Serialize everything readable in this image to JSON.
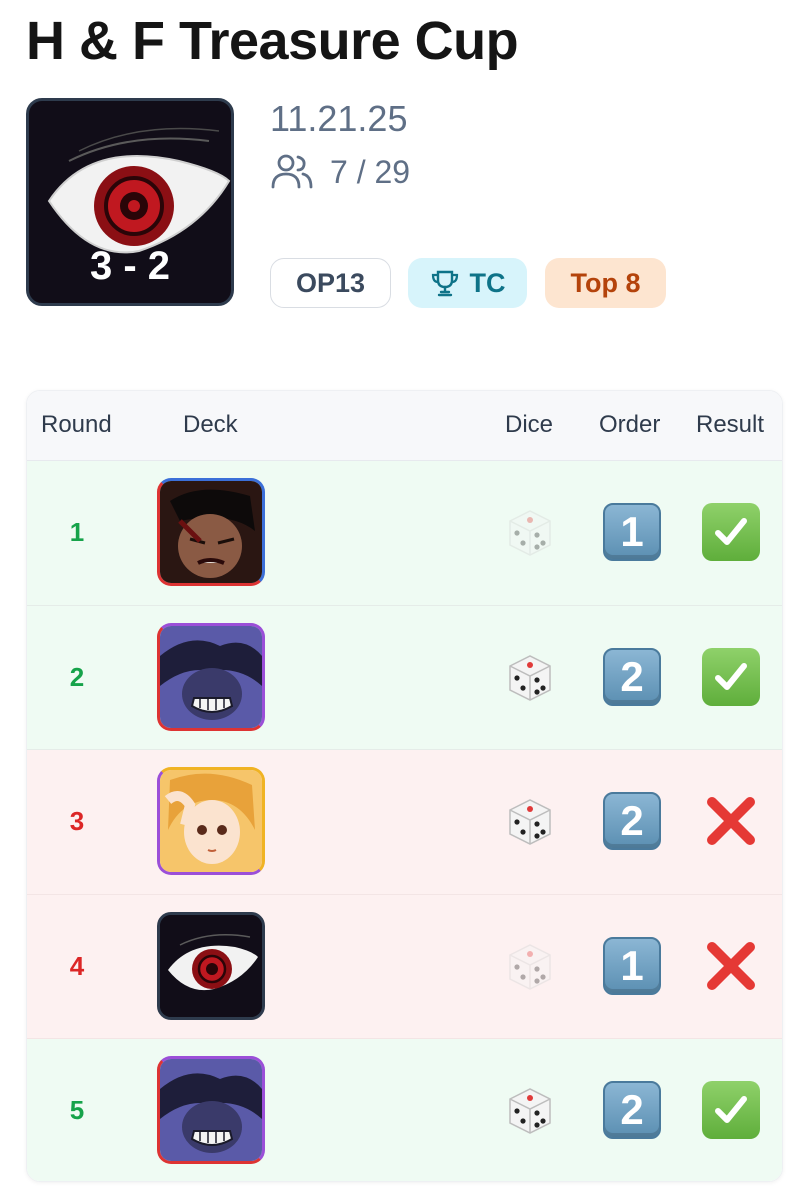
{
  "event": {
    "title": "H & F Treasure Cup",
    "date": "11.21.25",
    "players": "7 / 29",
    "score": "3 - 2"
  },
  "tags": {
    "set": "OP13",
    "type": "TC",
    "placement": "Top 8"
  },
  "table": {
    "headers": {
      "round": "Round",
      "deck": "Deck",
      "dice": "Dice",
      "order": "Order",
      "result": "Result"
    },
    "rows": [
      {
        "round": "1",
        "deck": "red-blue-leader",
        "dice": "lost",
        "order": "1",
        "result": "win"
      },
      {
        "round": "2",
        "deck": "red-purple-leader",
        "dice": "won",
        "order": "2",
        "result": "win"
      },
      {
        "round": "3",
        "deck": "purple-yellow-leader",
        "dice": "won",
        "order": "2",
        "result": "loss"
      },
      {
        "round": "4",
        "deck": "black-leader",
        "dice": "lost",
        "order": "1",
        "result": "loss"
      },
      {
        "round": "5",
        "deck": "red-purple-leader",
        "dice": "won",
        "order": "2",
        "result": "win"
      }
    ]
  },
  "colors": {
    "win": "#16a34a",
    "loss": "#dc2626",
    "tc_tag_bg": "#d7f4fb",
    "top_tag_bg": "#fde5d0"
  }
}
